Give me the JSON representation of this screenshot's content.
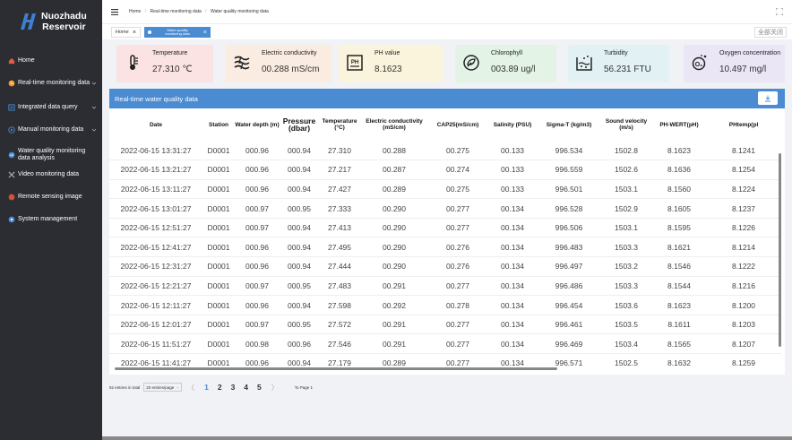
{
  "brand": {
    "line1": "Nuozhadu",
    "line2": "Reservoir"
  },
  "sidebar": {
    "items": [
      {
        "label": "Home",
        "icon": "home-icon",
        "has_chevron": false
      },
      {
        "label": "Real-time monitoring data",
        "icon": "realtime-icon",
        "has_chevron": true
      },
      {
        "label": "Integrated data query",
        "icon": "query-icon",
        "has_chevron": true
      },
      {
        "label": "Manual monitoring data",
        "icon": "manual-icon",
        "has_chevron": true
      },
      {
        "label": "Water quality monitoring data analysis",
        "icon": "analysis-icon",
        "has_chevron": false
      },
      {
        "label": "Video monitoring data",
        "icon": "video-icon",
        "has_chevron": false
      },
      {
        "label": "Remote sensing image",
        "icon": "remote-icon",
        "has_chevron": false
      },
      {
        "label": "System management",
        "icon": "system-icon",
        "has_chevron": false
      }
    ]
  },
  "breadcrumb": [
    "Home",
    "Real-time monitoring data",
    "Water quality monitoring data"
  ],
  "tabs": {
    "home": "Home",
    "active": "Water quality monitoring data",
    "close_all": "全部关闭"
  },
  "cards": [
    {
      "title": "Temperature",
      "value": "27.310 ℃",
      "bg": "#fbe3e3",
      "icon": "thermometer-icon"
    },
    {
      "title": "Electric conductivity",
      "value": "00.288 mS/cm",
      "bg": "#fbece2",
      "icon": "conductivity-icon"
    },
    {
      "title": "PH value",
      "value": "8.1623",
      "bg": "#fbf4dd",
      "icon": "ph-icon"
    },
    {
      "title": "Chlorophyll",
      "value": "003.89 ug/l",
      "bg": "#e3f3e6",
      "icon": "chlorophyll-icon"
    },
    {
      "title": "Turbidity",
      "value": "56.231 FTU",
      "bg": "#e2f2f4",
      "icon": "turbidity-icon"
    },
    {
      "title": "Oxygen concentration",
      "value": "10.497 mg/l",
      "bg": "#eae6f6",
      "icon": "oxygen-icon"
    }
  ],
  "panel": {
    "title": "Real-time water quality data"
  },
  "table": {
    "columns": [
      "Date",
      "Station",
      "Water depth (m)",
      "Pressure (dbar)",
      "Temperature (°C)",
      "Electric conductivity (mS/cm)",
      "CAP25(mS/cm)",
      "Salinity (PSU)",
      "Sigma-T (kg/m3)",
      "Sound velocity (m/s)",
      "PH-WERT(pH)",
      "PHtemp(pl"
    ],
    "rows": [
      [
        "2022-06-15 13:31:27",
        "D0001",
        "000.96",
        "000.94",
        "27.310",
        "00.288",
        "00.275",
        "00.133",
        "996.534",
        "1502.8",
        "8.1623",
        "8.1241"
      ],
      [
        "2022-06-15 13:21:27",
        "D0001",
        "000.96",
        "000.94",
        "27.217",
        "00.287",
        "00.274",
        "00.133",
        "996.559",
        "1502.6",
        "8.1636",
        "8.1254"
      ],
      [
        "2022-06-15 13:11:27",
        "D0001",
        "000.96",
        "000.94",
        "27.427",
        "00.289",
        "00.275",
        "00.133",
        "996.501",
        "1503.1",
        "8.1560",
        "8.1224"
      ],
      [
        "2022-06-15 13:01:27",
        "D0001",
        "000.97",
        "000.95",
        "27.333",
        "00.290",
        "00.277",
        "00.134",
        "996.528",
        "1502.9",
        "8.1605",
        "8.1237"
      ],
      [
        "2022-06-15 12:51:27",
        "D0001",
        "000.97",
        "000.94",
        "27.413",
        "00.290",
        "00.277",
        "00.134",
        "996.506",
        "1503.1",
        "8.1595",
        "8.1226"
      ],
      [
        "2022-06-15 12:41:27",
        "D0001",
        "000.96",
        "000.94",
        "27.495",
        "00.290",
        "00.276",
        "00.134",
        "996.483",
        "1503.3",
        "8.1621",
        "8.1214"
      ],
      [
        "2022-06-15 12:31:27",
        "D0001",
        "000.96",
        "000.94",
        "27.444",
        "00.290",
        "00.276",
        "00.134",
        "996.497",
        "1503.2",
        "8.1546",
        "8.1222"
      ],
      [
        "2022-06-15 12:21:27",
        "D0001",
        "000.97",
        "000.95",
        "27.483",
        "00.291",
        "00.277",
        "00.134",
        "996.486",
        "1503.3",
        "8.1544",
        "8.1216"
      ],
      [
        "2022-06-15 12:11:27",
        "D0001",
        "000.96",
        "000.94",
        "27.598",
        "00.292",
        "00.278",
        "00.134",
        "996.454",
        "1503.6",
        "8.1623",
        "8.1200"
      ],
      [
        "2022-06-15 12:01:27",
        "D0001",
        "000.97",
        "000.95",
        "27.572",
        "00.291",
        "00.277",
        "00.134",
        "996.461",
        "1503.5",
        "8.1611",
        "8.1203"
      ],
      [
        "2022-06-15 11:51:27",
        "D0001",
        "000.98",
        "000.96",
        "27.546",
        "00.291",
        "00.277",
        "00.134",
        "996.469",
        "1503.4",
        "8.1565",
        "8.1207"
      ],
      [
        "2022-06-15 11:41:27",
        "D0001",
        "000.96",
        "000.94",
        "27.179",
        "00.289",
        "00.277",
        "00.134",
        "996.571",
        "1502.5",
        "8.1632",
        "8.1259"
      ]
    ]
  },
  "pager": {
    "total_text": "92 entries in total",
    "page_size": "20 entries/page",
    "pages": [
      "1",
      "2",
      "3",
      "4",
      "5"
    ],
    "active_page": "1",
    "goto_text": "To Page 1"
  },
  "colors": {
    "accent": "#4a8bd1",
    "sidebar_bg": "#2b2d33"
  }
}
